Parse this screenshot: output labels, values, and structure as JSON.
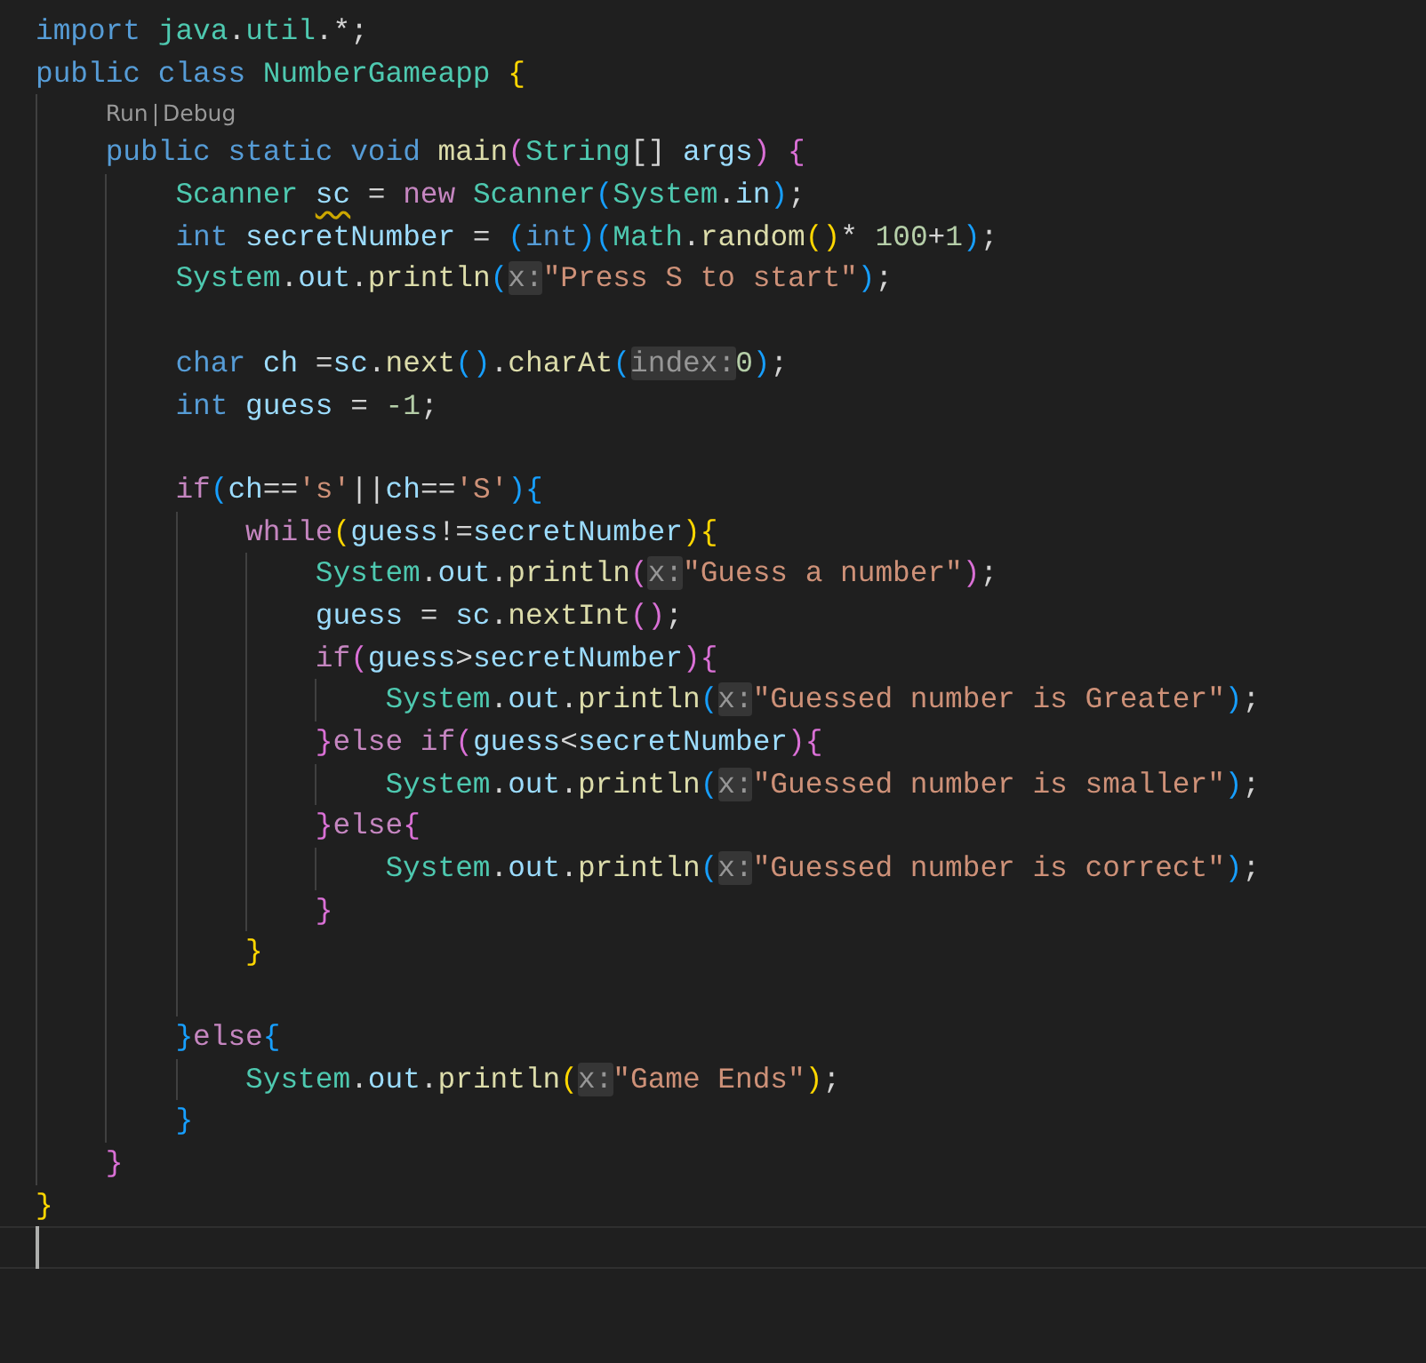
{
  "editor": {
    "lines": [
      {
        "kind": "code",
        "tokens": [
          {
            "text": "import ",
            "kind": "keyword"
          },
          {
            "text": "java",
            "kind": "type"
          },
          {
            "text": ".",
            "kind": "plain"
          },
          {
            "text": "util",
            "kind": "type"
          },
          {
            "text": ".*;",
            "kind": "plain"
          }
        ]
      },
      {
        "kind": "code",
        "tokens": [
          {
            "text": "public ",
            "kind": "keyword"
          },
          {
            "text": "class ",
            "kind": "keyword"
          },
          {
            "text": "NumberGameapp ",
            "kind": "type"
          },
          {
            "text": "{",
            "kind": "bracket1"
          }
        ],
        "children": [
          {
            "kind": "codelens",
            "actions": [
              "Run",
              "Debug"
            ],
            "separator": "|"
          },
          {
            "kind": "code",
            "tokens": [
              {
                "text": "public ",
                "kind": "keyword"
              },
              {
                "text": "static ",
                "kind": "keyword"
              },
              {
                "text": "void ",
                "kind": "keyword"
              },
              {
                "text": "main",
                "kind": "function"
              },
              {
                "text": "(",
                "kind": "bracket2"
              },
              {
                "text": "String",
                "kind": "type"
              },
              {
                "text": "[] ",
                "kind": "plain"
              },
              {
                "text": "args",
                "kind": "variable"
              },
              {
                "text": ")",
                "kind": "bracket2"
              },
              {
                "text": " {",
                "kind": "bracket2"
              }
            ],
            "children": [
              {
                "kind": "code",
                "tokens": [
                  {
                    "text": "Scanner ",
                    "kind": "type"
                  },
                  {
                    "text": "sc",
                    "kind": "variable",
                    "warning": true
                  },
                  {
                    "text": " = ",
                    "kind": "plain"
                  },
                  {
                    "text": "new ",
                    "kind": "control"
                  },
                  {
                    "text": "Scanner",
                    "kind": "type"
                  },
                  {
                    "text": "(",
                    "kind": "bracket3"
                  },
                  {
                    "text": "System",
                    "kind": "type"
                  },
                  {
                    "text": ".",
                    "kind": "plain"
                  },
                  {
                    "text": "in",
                    "kind": "variable"
                  },
                  {
                    "text": ")",
                    "kind": "bracket3"
                  },
                  {
                    "text": ";",
                    "kind": "plain"
                  }
                ]
              },
              {
                "kind": "code",
                "tokens": [
                  {
                    "text": "int ",
                    "kind": "keyword"
                  },
                  {
                    "text": "secretNumber",
                    "kind": "variable"
                  },
                  {
                    "text": " = ",
                    "kind": "plain"
                  },
                  {
                    "text": "(",
                    "kind": "bracket3"
                  },
                  {
                    "text": "int",
                    "kind": "keyword"
                  },
                  {
                    "text": ")",
                    "kind": "bracket3"
                  },
                  {
                    "text": "(",
                    "kind": "bracket3"
                  },
                  {
                    "text": "Math",
                    "kind": "type"
                  },
                  {
                    "text": ".",
                    "kind": "plain"
                  },
                  {
                    "text": "random",
                    "kind": "function"
                  },
                  {
                    "text": "()",
                    "kind": "bracket1"
                  },
                  {
                    "text": "* ",
                    "kind": "plain"
                  },
                  {
                    "text": "100",
                    "kind": "number"
                  },
                  {
                    "text": "+",
                    "kind": "plain"
                  },
                  {
                    "text": "1",
                    "kind": "number"
                  },
                  {
                    "text": ")",
                    "kind": "bracket3"
                  },
                  {
                    "text": ";",
                    "kind": "plain"
                  }
                ]
              },
              {
                "kind": "code",
                "tokens": [
                  {
                    "text": "System",
                    "kind": "type"
                  },
                  {
                    "text": ".",
                    "kind": "plain"
                  },
                  {
                    "text": "out",
                    "kind": "variable"
                  },
                  {
                    "text": ".",
                    "kind": "plain"
                  },
                  {
                    "text": "println",
                    "kind": "function"
                  },
                  {
                    "text": "(",
                    "kind": "bracket3"
                  },
                  {
                    "text": "x:",
                    "kind": "hint"
                  },
                  {
                    "text": "\"Press S to start\"",
                    "kind": "string"
                  },
                  {
                    "text": ")",
                    "kind": "bracket3"
                  },
                  {
                    "text": ";",
                    "kind": "plain"
                  }
                ]
              },
              {
                "kind": "blank"
              },
              {
                "kind": "code",
                "tokens": [
                  {
                    "text": "char ",
                    "kind": "keyword"
                  },
                  {
                    "text": "ch",
                    "kind": "variable"
                  },
                  {
                    "text": " =",
                    "kind": "plain"
                  },
                  {
                    "text": "sc",
                    "kind": "variable"
                  },
                  {
                    "text": ".",
                    "kind": "plain"
                  },
                  {
                    "text": "next",
                    "kind": "function"
                  },
                  {
                    "text": "()",
                    "kind": "bracket3"
                  },
                  {
                    "text": ".",
                    "kind": "plain"
                  },
                  {
                    "text": "charAt",
                    "kind": "function"
                  },
                  {
                    "text": "(",
                    "kind": "bracket3"
                  },
                  {
                    "text": "index:",
                    "kind": "hint"
                  },
                  {
                    "text": "0",
                    "kind": "number"
                  },
                  {
                    "text": ")",
                    "kind": "bracket3"
                  },
                  {
                    "text": ";",
                    "kind": "plain"
                  }
                ]
              },
              {
                "kind": "code",
                "tokens": [
                  {
                    "text": "int ",
                    "kind": "keyword"
                  },
                  {
                    "text": "guess",
                    "kind": "variable"
                  },
                  {
                    "text": " = ",
                    "kind": "plain"
                  },
                  {
                    "text": "-1",
                    "kind": "number"
                  },
                  {
                    "text": ";",
                    "kind": "plain"
                  }
                ]
              },
              {
                "kind": "blank"
              },
              {
                "kind": "code",
                "tokens": [
                  {
                    "text": "if",
                    "kind": "control"
                  },
                  {
                    "text": "(",
                    "kind": "bracket3"
                  },
                  {
                    "text": "ch",
                    "kind": "variable"
                  },
                  {
                    "text": "==",
                    "kind": "plain"
                  },
                  {
                    "text": "'s'",
                    "kind": "string"
                  },
                  {
                    "text": "||",
                    "kind": "plain"
                  },
                  {
                    "text": "ch",
                    "kind": "variable"
                  },
                  {
                    "text": "==",
                    "kind": "plain"
                  },
                  {
                    "text": "'S'",
                    "kind": "string"
                  },
                  {
                    "text": ")",
                    "kind": "bracket3"
                  },
                  {
                    "text": "{",
                    "kind": "bracket3"
                  }
                ],
                "children": [
                  {
                    "kind": "code",
                    "tokens": [
                      {
                        "text": "while",
                        "kind": "control"
                      },
                      {
                        "text": "(",
                        "kind": "bracket1"
                      },
                      {
                        "text": "guess",
                        "kind": "variable"
                      },
                      {
                        "text": "!=",
                        "kind": "plain"
                      },
                      {
                        "text": "secretNumber",
                        "kind": "variable"
                      },
                      {
                        "text": ")",
                        "kind": "bracket1"
                      },
                      {
                        "text": "{",
                        "kind": "bracket1"
                      }
                    ],
                    "children": [
                      {
                        "kind": "code",
                        "tokens": [
                          {
                            "text": "System",
                            "kind": "type"
                          },
                          {
                            "text": ".",
                            "kind": "plain"
                          },
                          {
                            "text": "out",
                            "kind": "variable"
                          },
                          {
                            "text": ".",
                            "kind": "plain"
                          },
                          {
                            "text": "println",
                            "kind": "function"
                          },
                          {
                            "text": "(",
                            "kind": "bracket2"
                          },
                          {
                            "text": "x:",
                            "kind": "hint"
                          },
                          {
                            "text": "\"Guess a number\"",
                            "kind": "string"
                          },
                          {
                            "text": ")",
                            "kind": "bracket2"
                          },
                          {
                            "text": ";",
                            "kind": "plain"
                          }
                        ]
                      },
                      {
                        "kind": "code",
                        "tokens": [
                          {
                            "text": "guess",
                            "kind": "variable"
                          },
                          {
                            "text": " = ",
                            "kind": "plain"
                          },
                          {
                            "text": "sc",
                            "kind": "variable"
                          },
                          {
                            "text": ".",
                            "kind": "plain"
                          },
                          {
                            "text": "nextInt",
                            "kind": "function"
                          },
                          {
                            "text": "()",
                            "kind": "bracket2"
                          },
                          {
                            "text": ";",
                            "kind": "plain"
                          }
                        ]
                      },
                      {
                        "kind": "code",
                        "tokens": [
                          {
                            "text": "if",
                            "kind": "control"
                          },
                          {
                            "text": "(",
                            "kind": "bracket2"
                          },
                          {
                            "text": "guess",
                            "kind": "variable"
                          },
                          {
                            "text": ">",
                            "kind": "plain"
                          },
                          {
                            "text": "secretNumber",
                            "kind": "variable"
                          },
                          {
                            "text": ")",
                            "kind": "bracket2"
                          },
                          {
                            "text": "{",
                            "kind": "bracket2"
                          }
                        ],
                        "children": [
                          {
                            "kind": "code",
                            "tokens": [
                              {
                                "text": "System",
                                "kind": "type"
                              },
                              {
                                "text": ".",
                                "kind": "plain"
                              },
                              {
                                "text": "out",
                                "kind": "variable"
                              },
                              {
                                "text": ".",
                                "kind": "plain"
                              },
                              {
                                "text": "println",
                                "kind": "function"
                              },
                              {
                                "text": "(",
                                "kind": "bracket3"
                              },
                              {
                                "text": "x:",
                                "kind": "hint"
                              },
                              {
                                "text": "\"Guessed number is Greater\"",
                                "kind": "string"
                              },
                              {
                                "text": ")",
                                "kind": "bracket3"
                              },
                              {
                                "text": ";",
                                "kind": "plain"
                              }
                            ]
                          }
                        ]
                      },
                      {
                        "kind": "code",
                        "tokens": [
                          {
                            "text": "}",
                            "kind": "bracket2"
                          },
                          {
                            "text": "else ",
                            "kind": "control"
                          },
                          {
                            "text": "if",
                            "kind": "control"
                          },
                          {
                            "text": "(",
                            "kind": "bracket2"
                          },
                          {
                            "text": "guess",
                            "kind": "variable"
                          },
                          {
                            "text": "<",
                            "kind": "plain"
                          },
                          {
                            "text": "secretNumber",
                            "kind": "variable"
                          },
                          {
                            "text": ")",
                            "kind": "bracket2"
                          },
                          {
                            "text": "{",
                            "kind": "bracket2"
                          }
                        ],
                        "children": [
                          {
                            "kind": "code",
                            "tokens": [
                              {
                                "text": "System",
                                "kind": "type"
                              },
                              {
                                "text": ".",
                                "kind": "plain"
                              },
                              {
                                "text": "out",
                                "kind": "variable"
                              },
                              {
                                "text": ".",
                                "kind": "plain"
                              },
                              {
                                "text": "println",
                                "kind": "function"
                              },
                              {
                                "text": "(",
                                "kind": "bracket3"
                              },
                              {
                                "text": "x:",
                                "kind": "hint"
                              },
                              {
                                "text": "\"Guessed number is smaller\"",
                                "kind": "string"
                              },
                              {
                                "text": ")",
                                "kind": "bracket3"
                              },
                              {
                                "text": ";",
                                "kind": "plain"
                              }
                            ]
                          }
                        ]
                      },
                      {
                        "kind": "code",
                        "tokens": [
                          {
                            "text": "}",
                            "kind": "bracket2"
                          },
                          {
                            "text": "else",
                            "kind": "control"
                          },
                          {
                            "text": "{",
                            "kind": "bracket2"
                          }
                        ],
                        "children": [
                          {
                            "kind": "code",
                            "tokens": [
                              {
                                "text": "System",
                                "kind": "type"
                              },
                              {
                                "text": ".",
                                "kind": "plain"
                              },
                              {
                                "text": "out",
                                "kind": "variable"
                              },
                              {
                                "text": ".",
                                "kind": "plain"
                              },
                              {
                                "text": "println",
                                "kind": "function"
                              },
                              {
                                "text": "(",
                                "kind": "bracket3"
                              },
                              {
                                "text": "x:",
                                "kind": "hint"
                              },
                              {
                                "text": "\"Guessed number is correct\"",
                                "kind": "string"
                              },
                              {
                                "text": ")",
                                "kind": "bracket3"
                              },
                              {
                                "text": ";",
                                "kind": "plain"
                              }
                            ]
                          }
                        ]
                      },
                      {
                        "kind": "code",
                        "tokens": [
                          {
                            "text": "}",
                            "kind": "bracket2"
                          }
                        ]
                      }
                    ]
                  },
                  {
                    "kind": "code",
                    "tokens": [
                      {
                        "text": "}",
                        "kind": "bracket1"
                      }
                    ]
                  },
                  {
                    "kind": "blank"
                  }
                ]
              },
              {
                "kind": "code",
                "tokens": [
                  {
                    "text": "}",
                    "kind": "bracket3"
                  },
                  {
                    "text": "else",
                    "kind": "control"
                  },
                  {
                    "text": "{",
                    "kind": "bracket3"
                  }
                ],
                "children": [
                  {
                    "kind": "code",
                    "tokens": [
                      {
                        "text": "System",
                        "kind": "type"
                      },
                      {
                        "text": ".",
                        "kind": "plain"
                      },
                      {
                        "text": "out",
                        "kind": "variable"
                      },
                      {
                        "text": ".",
                        "kind": "plain"
                      },
                      {
                        "text": "println",
                        "kind": "function"
                      },
                      {
                        "text": "(",
                        "kind": "bracket1"
                      },
                      {
                        "text": "x:",
                        "kind": "hint"
                      },
                      {
                        "text": "\"Game Ends\"",
                        "kind": "string"
                      },
                      {
                        "text": ")",
                        "kind": "bracket1"
                      },
                      {
                        "text": ";",
                        "kind": "plain"
                      }
                    ]
                  }
                ]
              },
              {
                "kind": "code",
                "tokens": [
                  {
                    "text": "}",
                    "kind": "bracket3"
                  }
                ]
              }
            ]
          },
          {
            "kind": "code",
            "tokens": [
              {
                "text": "}",
                "kind": "bracket2"
              }
            ]
          }
        ]
      },
      {
        "kind": "code",
        "tokens": [
          {
            "text": "}",
            "kind": "bracket1"
          }
        ]
      },
      {
        "kind": "blank",
        "current": true
      }
    ]
  }
}
